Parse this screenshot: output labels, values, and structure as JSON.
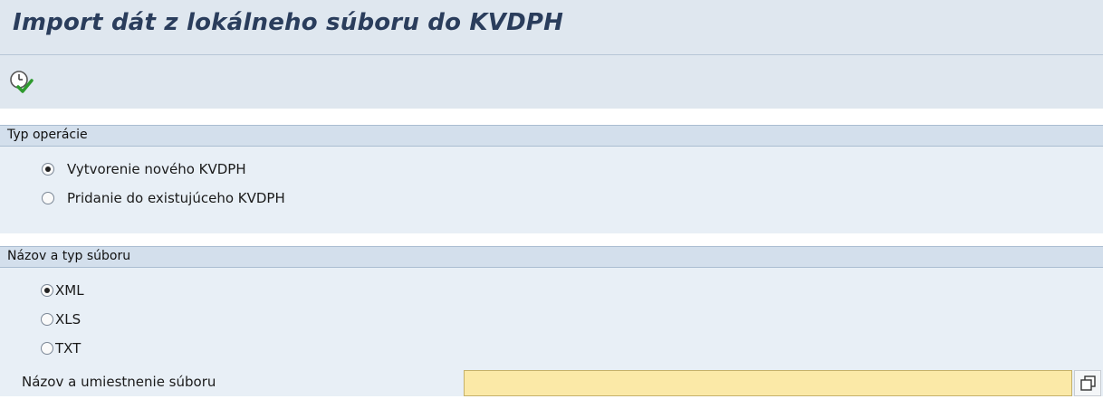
{
  "header": {
    "title": "Import dát z lokálneho súboru do KVDPH"
  },
  "toolbar": {
    "execute_icon": "execute-clock-check-icon"
  },
  "operation_type": {
    "title": "Typ operácie",
    "options": [
      {
        "label": "Vytvorenie nového KVDPH",
        "selected": true
      },
      {
        "label": "Pridanie do existujúceho KVDPH",
        "selected": false
      }
    ]
  },
  "file": {
    "title": "Názov a typ súboru",
    "formats": [
      {
        "label": "XML",
        "selected": true
      },
      {
        "label": "XLS",
        "selected": false
      },
      {
        "label": "TXT",
        "selected": false
      }
    ],
    "path_label": "Názov a umiestnenie súboru",
    "path_value": "",
    "browse_icon": "copy-window-icon"
  },
  "colors": {
    "header_bg": "#dfe7ef",
    "section_bg": "#e8eff6",
    "section_header_bg": "#d3dfec",
    "title_color": "#2a3d5c",
    "required_field_bg": "#fbe9a7"
  }
}
